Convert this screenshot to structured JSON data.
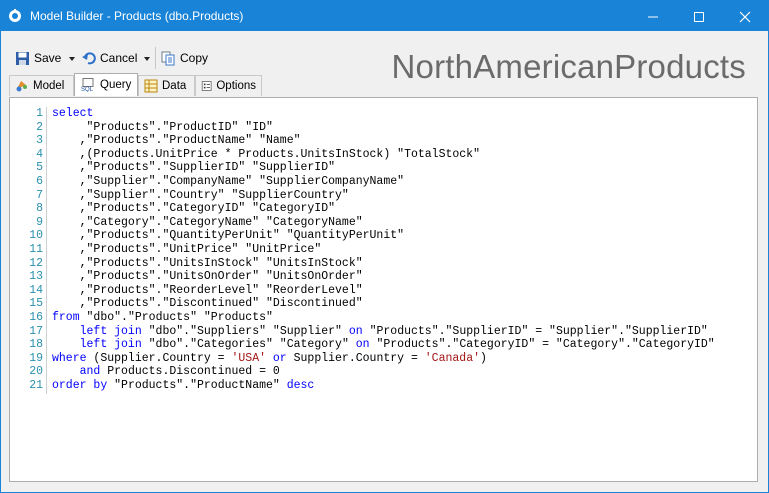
{
  "window": {
    "title": "Model Builder - Products (dbo.Products)"
  },
  "toolbar": {
    "save_label": "Save",
    "cancel_label": "Cancel",
    "copy_label": "Copy"
  },
  "brand_text": "NorthAmericanProducts",
  "tabs": [
    {
      "label": "Model",
      "icon": "model-icon"
    },
    {
      "label": "Query",
      "icon": "sql-icon",
      "active": true
    },
    {
      "label": "Data",
      "icon": "data-grid-icon"
    },
    {
      "label": "Options",
      "icon": "options-icon"
    }
  ],
  "code": [
    {
      "n": "1",
      "text": "select"
    },
    {
      "n": "2",
      "text": "     \"Products\".\"ProductID\" \"ID\""
    },
    {
      "n": "3",
      "text": "    ,\"Products\".\"ProductName\" \"Name\""
    },
    {
      "n": "4",
      "text": "    ,(Products.UnitPrice * Products.UnitsInStock) \"TotalStock\""
    },
    {
      "n": "5",
      "text": "    ,\"Products\".\"SupplierID\" \"SupplierID\""
    },
    {
      "n": "6",
      "text": "    ,\"Supplier\".\"CompanyName\" \"SupplierCompanyName\""
    },
    {
      "n": "7",
      "text": "    ,\"Supplier\".\"Country\" \"SupplierCountry\""
    },
    {
      "n": "8",
      "text": "    ,\"Products\".\"CategoryID\" \"CategoryID\""
    },
    {
      "n": "9",
      "text": "    ,\"Category\".\"CategoryName\" \"CategoryName\""
    },
    {
      "n": "10",
      "text": "    ,\"Products\".\"QuantityPerUnit\" \"QuantityPerUnit\""
    },
    {
      "n": "11",
      "text": "    ,\"Products\".\"UnitPrice\" \"UnitPrice\""
    },
    {
      "n": "12",
      "text": "    ,\"Products\".\"UnitsInStock\" \"UnitsInStock\""
    },
    {
      "n": "13",
      "text": "    ,\"Products\".\"UnitsOnOrder\" \"UnitsOnOrder\""
    },
    {
      "n": "14",
      "text": "    ,\"Products\".\"ReorderLevel\" \"ReorderLevel\""
    },
    {
      "n": "15",
      "text": "    ,\"Products\".\"Discontinued\" \"Discontinued\""
    },
    {
      "n": "16",
      "text": "from \"dbo\".\"Products\" \"Products\""
    },
    {
      "n": "17",
      "text": "    left join \"dbo\".\"Suppliers\" \"Supplier\" on \"Products\".\"SupplierID\" = \"Supplier\".\"SupplierID\""
    },
    {
      "n": "18",
      "text": "    left join \"dbo\".\"Categories\" \"Category\" on \"Products\".\"CategoryID\" = \"Category\".\"CategoryID\""
    },
    {
      "n": "19",
      "text": "where (Supplier.Country = 'USA' or Supplier.Country = 'Canada')"
    },
    {
      "n": "20",
      "text": "    and Products.Discontinued = 0"
    },
    {
      "n": "21",
      "text": "order by \"Products\".\"ProductName\" desc"
    }
  ]
}
